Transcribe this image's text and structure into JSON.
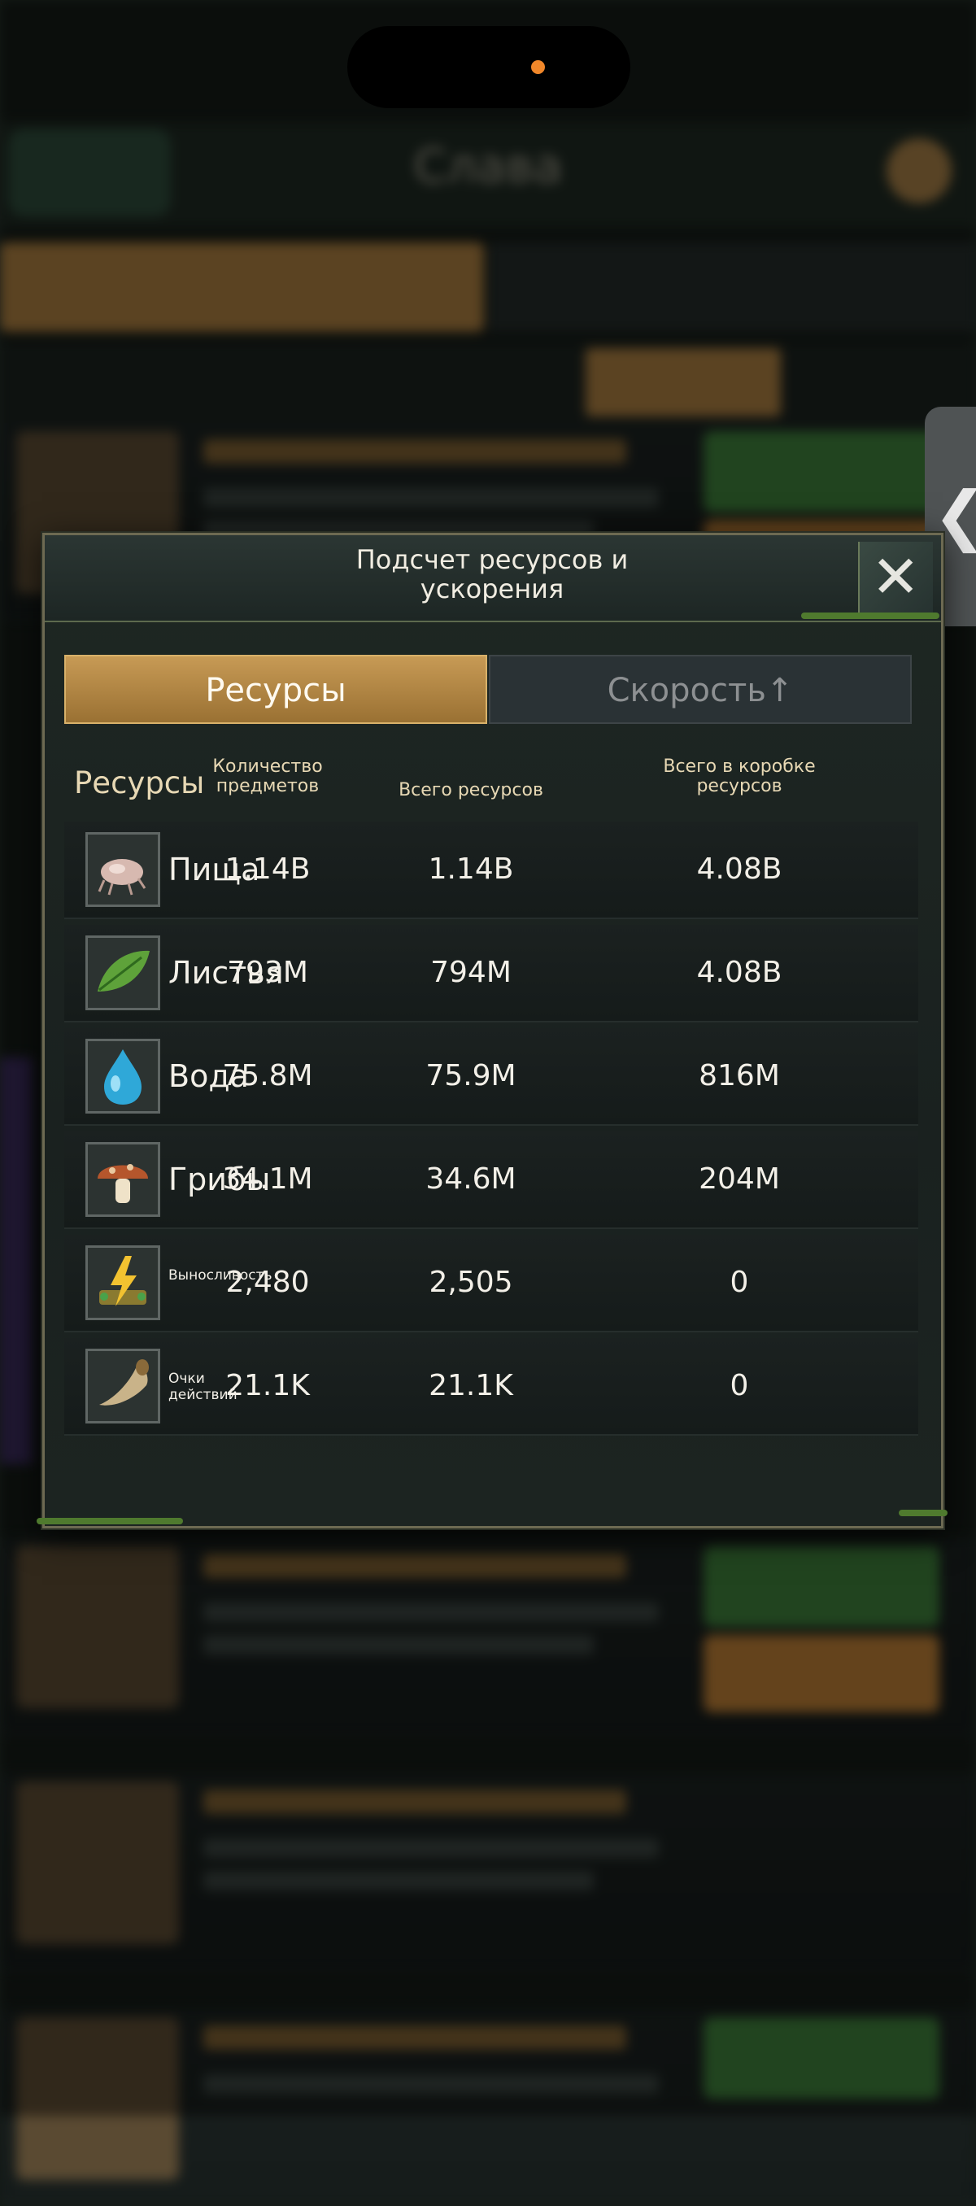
{
  "modal": {
    "title": "Подсчет ресурсов и ускорения",
    "tabs": [
      {
        "label": "Ресурсы",
        "active": true
      },
      {
        "label": "Скорость↑",
        "active": false
      }
    ],
    "columns": {
      "resource": "Ресурсы",
      "quantity": "Количество предметов",
      "total": "Всего ресурсов",
      "box_total": "Всего в коробке ресурсов"
    },
    "rows": [
      {
        "icon": "food-icon",
        "name": "Пища",
        "quantity": "1.14B",
        "total": "1.14B",
        "box_total": "4.08B"
      },
      {
        "icon": "leaves-icon",
        "name": "Листья",
        "quantity": "793M",
        "total": "794M",
        "box_total": "4.08B"
      },
      {
        "icon": "water-icon",
        "name": "Вода",
        "quantity": "75.8M",
        "total": "75.9M",
        "box_total": "816M"
      },
      {
        "icon": "mushroom-icon",
        "name": "Грибы",
        "quantity": "34.1M",
        "total": "34.6M",
        "box_total": "204M"
      },
      {
        "icon": "stamina-icon",
        "name": "Выносливость",
        "quantity": "2,480",
        "total": "2,505",
        "box_total": "0"
      },
      {
        "icon": "horn-icon",
        "name": "Очки действий",
        "quantity": "21.1K",
        "total": "21.1K",
        "box_total": "0"
      }
    ]
  },
  "background": {
    "screen_title": "Слава"
  },
  "colors": {
    "active_tab": "#b88a47",
    "inactive_tab": "#2a3235",
    "modal_bg": "#1c2421",
    "header_text": "#e7d8b4",
    "accent_green": "#3c7d3a",
    "accent_orange": "#b77a34"
  }
}
